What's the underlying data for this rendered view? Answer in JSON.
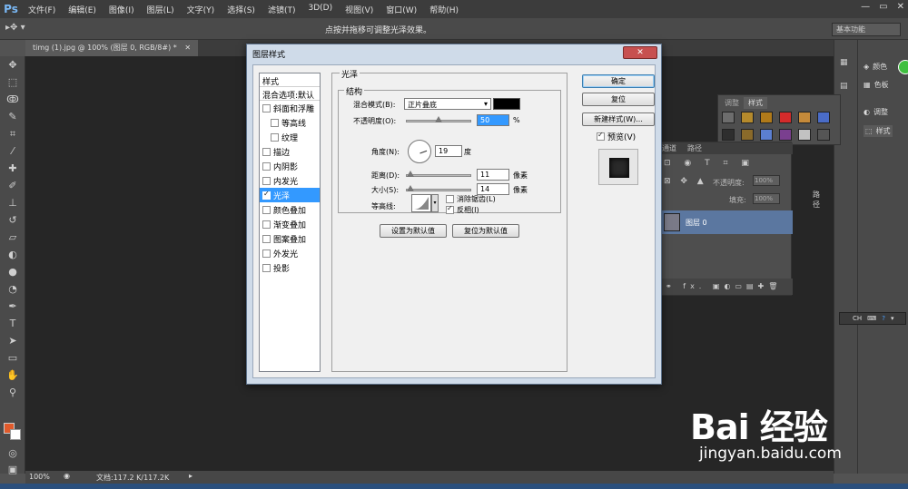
{
  "menubar": {
    "logo": "Ps",
    "items": [
      "文件(F)",
      "编辑(E)",
      "图像(I)",
      "图层(L)",
      "文字(Y)",
      "选择(S)",
      "滤镜(T)",
      "3D(D)",
      "视图(V)",
      "窗口(W)",
      "帮助(H)"
    ],
    "window_controls": [
      "—",
      "▭",
      "✕"
    ]
  },
  "optbar": {
    "hint": "点按并拖移可调整光泽效果。",
    "workspace": "基本功能"
  },
  "document": {
    "tab": "timg (1).jpg @ 100% (图层 0, RGB/8#) *",
    "tab_close": "✕"
  },
  "statusbar": {
    "zoom": "100%",
    "doc_info": "文档:117.2 K/117.2K"
  },
  "rightpanel": {
    "items": [
      "颜色",
      "色板",
      "调整",
      "样式"
    ]
  },
  "stylespanel": {
    "tabs": [
      "样式",
      "调整"
    ],
    "swatch_colors": [
      "#6d6d6d",
      "#b58a2c",
      "#b07a1a",
      "#d42b2b",
      "#c58a3a",
      "#4a6cc7",
      "#2e2e2e",
      "#8a6a2a",
      "#5b7fd1",
      "#7a3f8f",
      "#c2c2c2",
      "#555555"
    ]
  },
  "layerspanel": {
    "tabs": [
      "通道",
      "路径"
    ],
    "opacity_label": "不透明度:",
    "opacity_value": "100%",
    "fill_label": "填充:",
    "fill_value": "100%",
    "path_label": "路径",
    "layer_name": "图层 0",
    "footer_fx": "fx."
  },
  "ime": {
    "label": "CH"
  },
  "dialog": {
    "title": "图层样式",
    "close": "✕",
    "style_list_header": "样式",
    "blend_options": "混合选项:默认",
    "styles": [
      {
        "label": "斜面和浮雕",
        "checked": false,
        "indent": false,
        "active": false
      },
      {
        "label": "等高线",
        "checked": false,
        "indent": true,
        "active": false
      },
      {
        "label": "纹理",
        "checked": false,
        "indent": true,
        "active": false
      },
      {
        "label": "描边",
        "checked": false,
        "indent": false,
        "active": false
      },
      {
        "label": "内阴影",
        "checked": false,
        "indent": false,
        "active": false
      },
      {
        "label": "内发光",
        "checked": false,
        "indent": false,
        "active": false
      },
      {
        "label": "光泽",
        "checked": true,
        "indent": false,
        "active": true
      },
      {
        "label": "颜色叠加",
        "checked": false,
        "indent": false,
        "active": false
      },
      {
        "label": "渐变叠加",
        "checked": false,
        "indent": false,
        "active": false
      },
      {
        "label": "图案叠加",
        "checked": false,
        "indent": false,
        "active": false
      },
      {
        "label": "外发光",
        "checked": false,
        "indent": false,
        "active": false
      },
      {
        "label": "投影",
        "checked": false,
        "indent": false,
        "active": false
      }
    ],
    "section_title": "光泽",
    "structure_title": "结构",
    "blend_mode_label": "混合模式(B):",
    "blend_mode_value": "正片叠底",
    "color_value": "#000000",
    "opacity_label": "不透明度(O):",
    "opacity_value": "50",
    "opacity_unit": "%",
    "opacity_fraction": 0.5,
    "angle_label": "角度(N):",
    "angle_value": "19",
    "angle_unit": "度",
    "distance_label": "距离(D):",
    "distance_value": "11",
    "distance_unit": "像素",
    "distance_fraction": 0.05,
    "size_label": "大小(S):",
    "size_value": "14",
    "size_unit": "像素",
    "size_fraction": 0.06,
    "contour_label": "等高线:",
    "antialias_label": "消除锯齿(L)",
    "antialias_checked": false,
    "invert_label": "反相(I)",
    "invert_checked": true,
    "set_default": "设置为默认值",
    "reset_default": "复位为默认值",
    "ok": "确定",
    "reset": "复位",
    "new_style": "新建样式(W)...",
    "preview_label": "预览(V)",
    "preview_checked": true
  },
  "watermark": {
    "logo": "Bai 经验",
    "url": "jingyan.baidu.com"
  }
}
